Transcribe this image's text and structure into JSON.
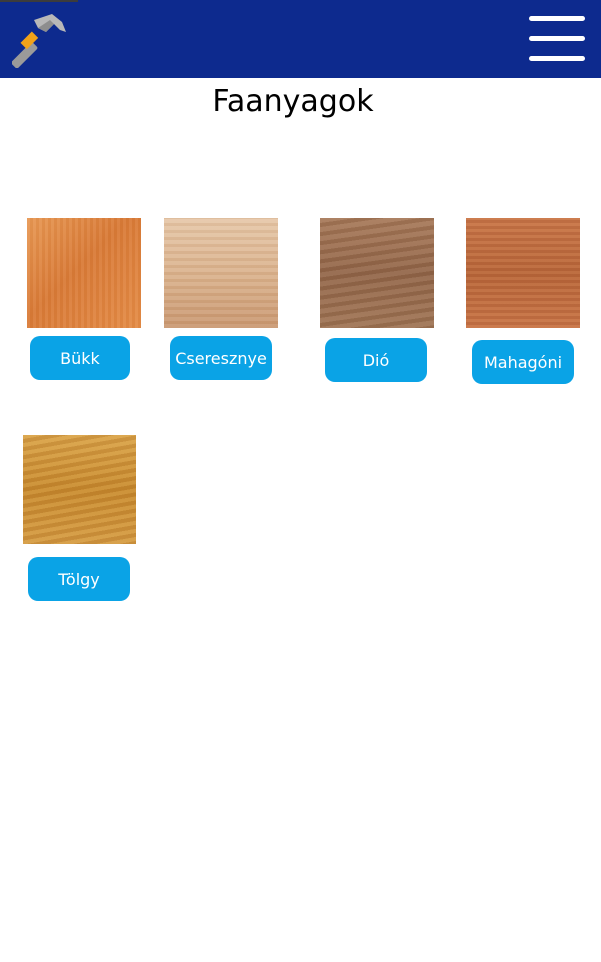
{
  "header": {
    "logo_icon": "hammer-icon",
    "menu_icon": "hamburger-menu-icon",
    "background": "#0d2a8e"
  },
  "page": {
    "title": "Faanyagok"
  },
  "woods": [
    {
      "label": "Bükk",
      "swatch": "#df8a45"
    },
    {
      "label": "Cseresznye",
      "swatch": "#dcb791"
    },
    {
      "label": "Dió",
      "swatch": "#9c7050"
    },
    {
      "label": "Mahagóni",
      "swatch": "#c06f42"
    },
    {
      "label": "Tölgy",
      "swatch": "#d1943d"
    }
  ],
  "accent_button_color": "#0aa3e6"
}
